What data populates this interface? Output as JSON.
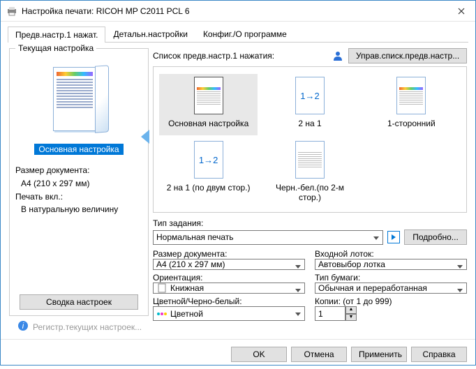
{
  "window": {
    "title": "Настройка печати: RICOH MP C2011 PCL 6"
  },
  "tabs": {
    "t0": "Предв.настр.1 нажат.",
    "t1": "Детальн.настройки",
    "t2": "Конфиг./О программе"
  },
  "left": {
    "group_title": "Текущая настройка",
    "preset_name": "Основная настройка",
    "doc_size_label": "Размер документа:",
    "doc_size_value": "A4 (210 x 297 мм)",
    "print_on_label": "Печать вкл.:",
    "print_on_value": "В натуральную величину",
    "summary_btn": "Сводка настроек"
  },
  "register_link": "Регистр.текущих настроек...",
  "right": {
    "list_label": "Список предв.настр.1 нажатия:",
    "manage_btn": "Управ.списк.предв.настр...",
    "presets": {
      "p0": "Основная настройка",
      "p1": "2 на 1",
      "p2": "1-сторонний",
      "p3": "2 на 1 (по двум стор.)",
      "p4": "Черн.-бел.(по 2-м стор.)",
      "arrow12": "1→2"
    },
    "job_type_label": "Тип задания:",
    "job_type_value": "Нормальная печать",
    "details_btn": "Подробно...",
    "doc_size_label": "Размер документа:",
    "doc_size_value": "A4 (210 x 297 мм)",
    "tray_label": "Входной лоток:",
    "tray_value": "Автовыбор лотка",
    "orient_label": "Ориентация:",
    "orient_value": "Книжная",
    "paper_label": "Тип бумаги:",
    "paper_value": "Обычная и переработанная",
    "color_label": "Цветной/Черно-белый:",
    "color_value": "Цветной",
    "copies_label": "Копии: (от 1 до 999)",
    "copies_value": "1"
  },
  "buttons": {
    "ok": "OK",
    "cancel": "Отмена",
    "apply": "Применить",
    "help": "Справка"
  }
}
